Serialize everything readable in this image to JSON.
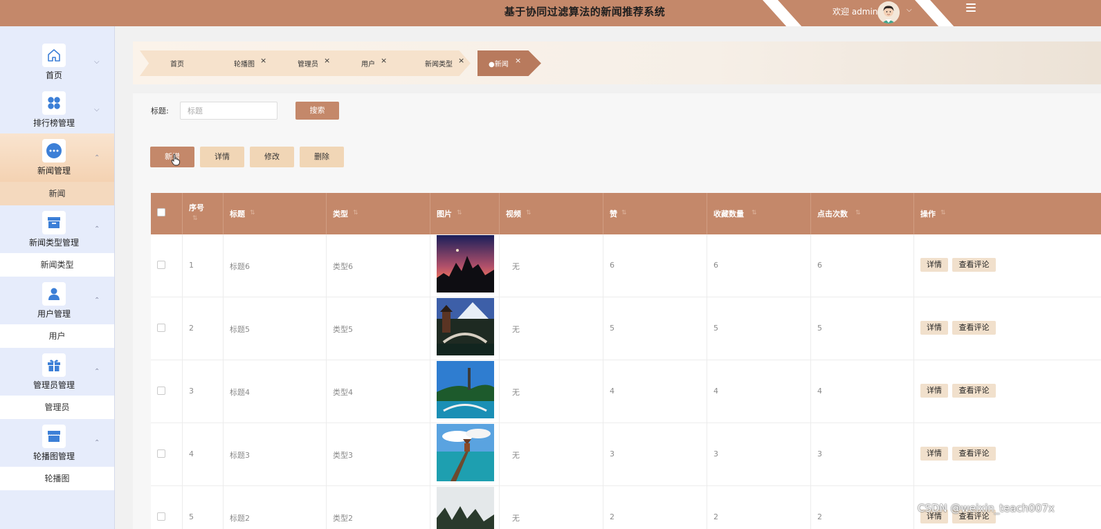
{
  "header": {
    "title": "基于协同过滤算法的新闻推荐系统",
    "welcome": "欢迎 admin",
    "user_chevron": "⌵"
  },
  "sidebar": {
    "groups": [
      {
        "label": "首页",
        "icon": "home-icon",
        "arrow": "⌵"
      },
      {
        "label": "排行榜管理",
        "icon": "grid-icon",
        "arrow": "⌵"
      },
      {
        "label": "新闻管理",
        "icon": "more-circle-icon",
        "arrow": "⌃",
        "sub": "新闻"
      },
      {
        "label": "新闻类型管理",
        "icon": "archive-icon",
        "arrow": "⌃",
        "sub": "新闻类型"
      },
      {
        "label": "用户管理",
        "icon": "user-icon",
        "arrow": "⌃",
        "sub": "用户"
      },
      {
        "label": "管理员管理",
        "icon": "gift-icon",
        "arrow": "⌃",
        "sub": "管理员"
      },
      {
        "label": "轮播图管理",
        "icon": "shop-icon",
        "arrow": "⌃",
        "sub": "轮播图"
      }
    ]
  },
  "tabs": [
    {
      "label": "首页",
      "closable": false
    },
    {
      "label": "轮播图",
      "close": "×"
    },
    {
      "label": "管理员",
      "close": "×"
    },
    {
      "label": "用户",
      "close": "×"
    },
    {
      "label": "新闻类型",
      "close": "×"
    },
    {
      "label": "●新闻",
      "close": "×",
      "active": true
    }
  ],
  "search": {
    "label": "标题:",
    "placeholder": "标题",
    "button": "搜索"
  },
  "actions": {
    "add": "新增",
    "detail": "详情",
    "edit": "修改",
    "delete": "删除"
  },
  "table": {
    "columns": [
      "序号",
      "标题",
      "类型",
      "图片",
      "视频",
      "赞",
      "收藏数量",
      "点击次数",
      "操作"
    ],
    "sort_mark": "⇅",
    "rows": [
      {
        "index": "1",
        "title": "标题6",
        "type": "类型6",
        "video": "无",
        "likes": "6",
        "favorites": "6",
        "clicks": "6"
      },
      {
        "index": "2",
        "title": "标题5",
        "type": "类型5",
        "video": "无",
        "likes": "5",
        "favorites": "5",
        "clicks": "5"
      },
      {
        "index": "3",
        "title": "标题4",
        "type": "类型4",
        "video": "无",
        "likes": "4",
        "favorites": "4",
        "clicks": "4"
      },
      {
        "index": "4",
        "title": "标题3",
        "type": "类型3",
        "video": "无",
        "likes": "3",
        "favorites": "3",
        "clicks": "3"
      },
      {
        "index": "5",
        "title": "标题2",
        "type": "类型2",
        "video": "无",
        "likes": "2",
        "favorites": "2",
        "clicks": "2"
      }
    ],
    "row_actions": {
      "detail": "详情",
      "comments": "查看评论"
    }
  },
  "watermark": "CSDN @weixin_teach007x",
  "colors": {
    "primary": "#c4886a",
    "light": "#f1d6b6",
    "sidebar": "#e6ecfb"
  }
}
